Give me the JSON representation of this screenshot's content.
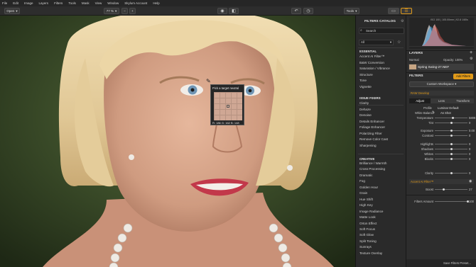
{
  "menubar": [
    "File",
    "Edit",
    "Image",
    "Layers",
    "Filters",
    "Tools",
    "Mask",
    "View",
    "Window",
    "Skylum Account",
    "Help"
  ],
  "toolbar": {
    "open_label": "Open",
    "zoom_label": "77 %",
    "minus_label": "−",
    "plus_label": "+",
    "tools_label": "Tools"
  },
  "picker": {
    "title": "Pick a target neutral",
    "rgb": "R: 186 G: 162 B: 148"
  },
  "catalog": {
    "title": "FILTERS CATALOG",
    "search_placeholder": "Search",
    "select_value": "All",
    "sections": {
      "essential": "ESSENTIAL",
      "issue": "ISSUE FIXERS",
      "creative": "CREATIVE"
    },
    "essential_items": [
      "Accent AI Filter™",
      "B&W Conversion",
      "Saturation / Vibrance",
      "Structure",
      "Tone",
      "Vignette"
    ],
    "issue_items": [
      "Clarity",
      "Dehaze",
      "Denoise",
      "Details Enhancer",
      "Foliage Enhancer",
      "Polarizing Filter",
      "Remove Color Cast",
      "Sharpening"
    ],
    "creative_items": [
      "Brilliance / Warmth",
      "Cross Processing",
      "Dramatic",
      "Fog",
      "Golden Hour",
      "Grain",
      "Hue Shift",
      "High Key",
      "Image Radiance",
      "Matte Look",
      "Orton Effect",
      "Soft Focus",
      "Soft Glow",
      "Split Toning",
      "Sunrays",
      "Texture Overlay"
    ]
  },
  "panel": {
    "histogram_info": "ISO 100 | 105.00mm | f/2.8",
    "histogram_side": "1/80s",
    "layers_title": "LAYERS",
    "blend_mode": "Normal",
    "opacity_label": "Opacity: 100%",
    "layer_name": "Spring Swing-27.NEF",
    "filters_title": "FILTERS",
    "add_filters": "Add Filters",
    "workspace": "Custom Workspace",
    "raw_develop": "RAW Develop",
    "tabs": [
      "Adjust",
      "Lens",
      "Transform"
    ],
    "profile_label": "Profile",
    "profile_value": "Luminar Default",
    "wb_label": "White Balance",
    "wb_value": "As Shot",
    "sliders_a": [
      {
        "label": "Temperature",
        "value": "5808",
        "pos": 0.55
      },
      {
        "label": "Tint",
        "value": "0",
        "pos": 0.5
      }
    ],
    "sliders_b": [
      {
        "label": "Exposure",
        "value": "0.00",
        "pos": 0.5
      },
      {
        "label": "Contrast",
        "value": "0",
        "pos": 0.5
      }
    ],
    "sliders_c": [
      {
        "label": "Highlights",
        "value": "0",
        "pos": 0.5
      },
      {
        "label": "Shadows",
        "value": "0",
        "pos": 0.5
      },
      {
        "label": "Whites",
        "value": "0",
        "pos": 0.5
      },
      {
        "label": "Blacks",
        "value": "0",
        "pos": 0.5
      }
    ],
    "clarity": {
      "label": "Clarity",
      "value": "0",
      "pos": 0.5
    },
    "accent_title": "Accent AI Filter™",
    "boost": {
      "label": "Boost",
      "value": "27",
      "pos": 0.27
    },
    "amount": {
      "label": "Filters Amount",
      "value": "100",
      "pos": 1.0
    },
    "save_button": "Save Filters Preset..."
  },
  "colors": {
    "accent": "#e09a1a",
    "panel": "#2d2d2d",
    "catalog": "#2a2a2a"
  }
}
